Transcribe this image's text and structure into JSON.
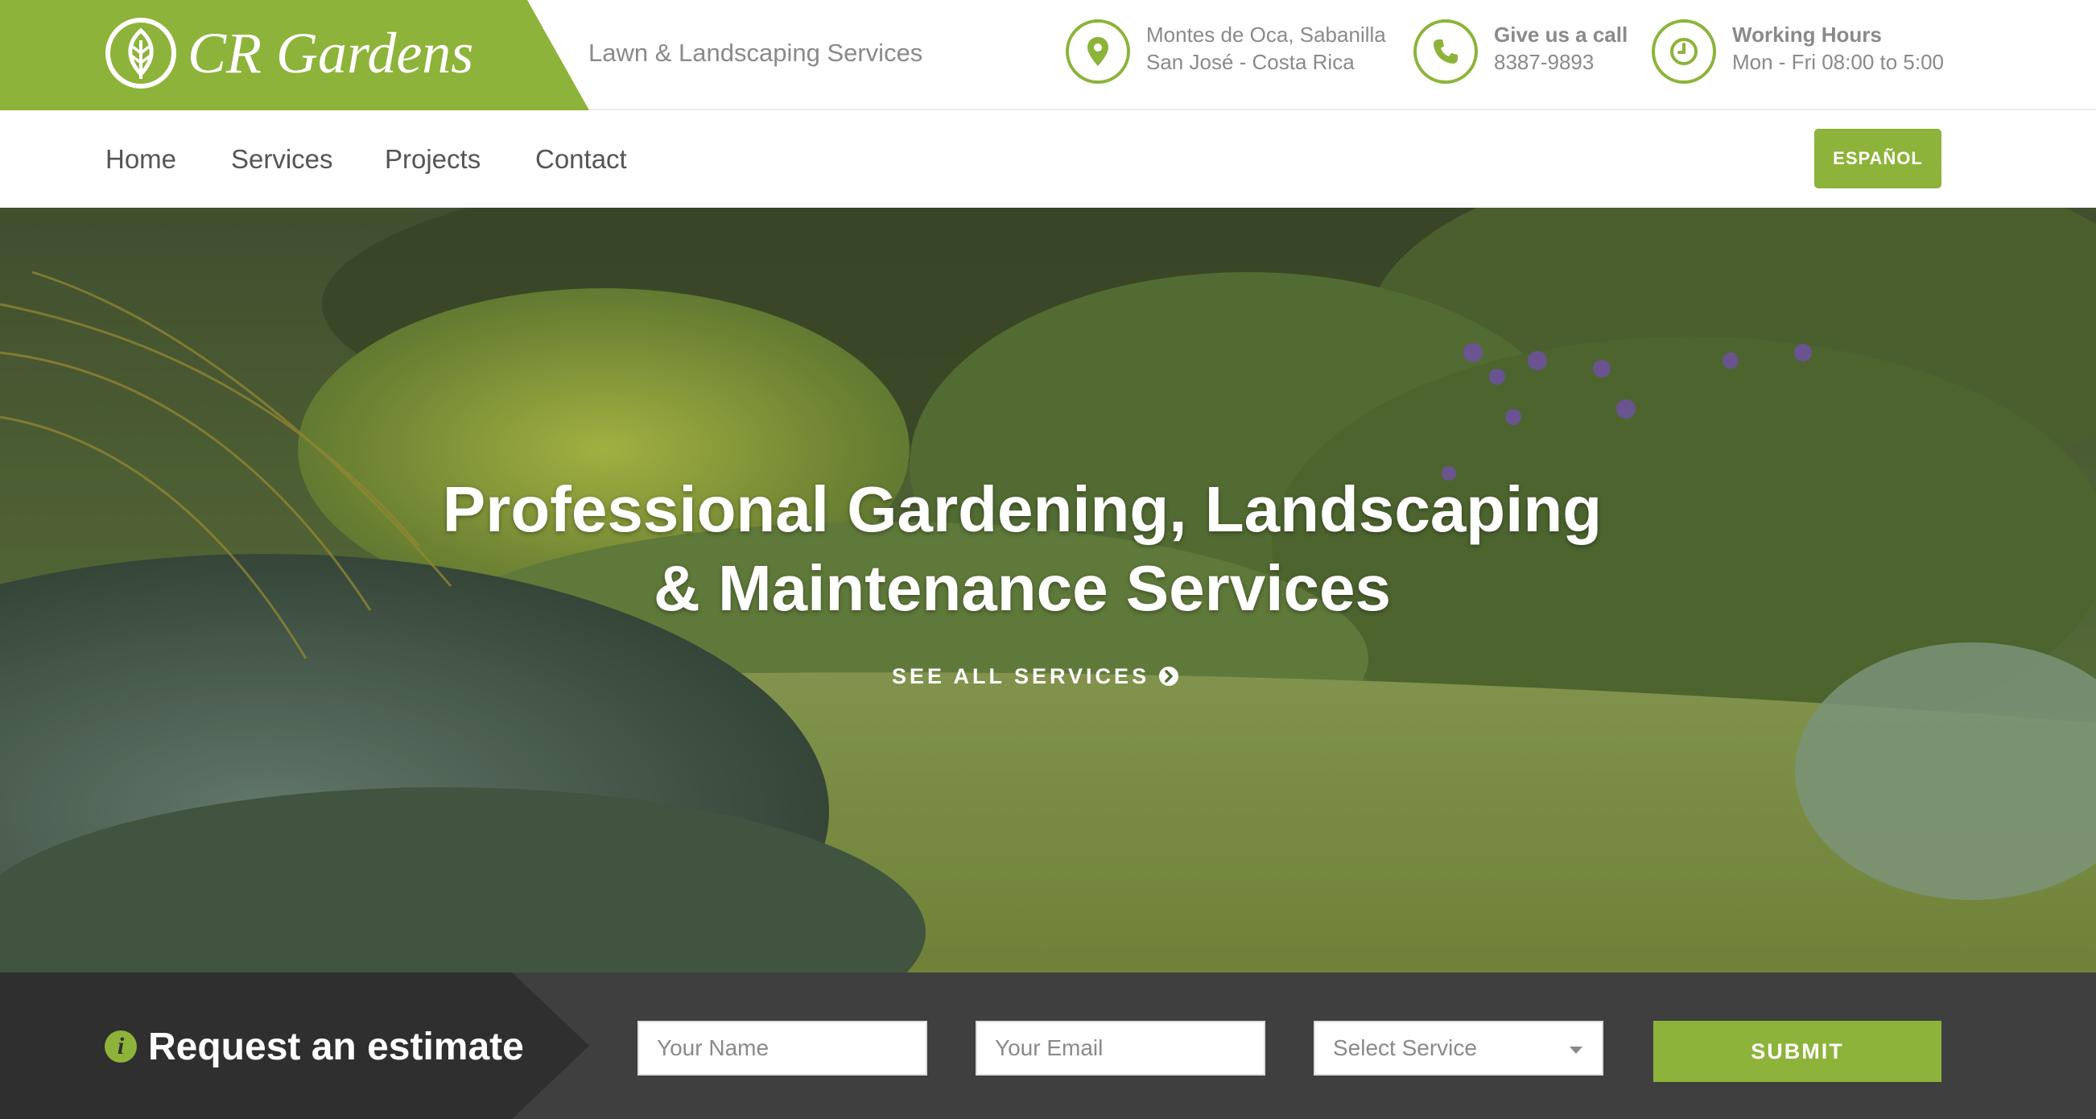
{
  "brand": {
    "name": "CR Gardens",
    "tagline": "Lawn & Landscaping Services",
    "logo_icon": "leaf-icon",
    "accent_color": "#8db33a"
  },
  "contact_info": {
    "location": {
      "icon": "map-pin-icon",
      "line1": "Montes de Oca, Sabanilla",
      "line2": "San José - Costa Rica"
    },
    "phone": {
      "icon": "phone-icon",
      "title": "Give us a call",
      "number": "8387-9893"
    },
    "hours": {
      "icon": "clock-icon",
      "title": "Working Hours",
      "schedule": "Mon - Fri 08:00 to 5:00"
    }
  },
  "nav": {
    "items": [
      "Home",
      "Services",
      "Projects",
      "Contact"
    ],
    "language_button": "ESPAÑOL"
  },
  "hero": {
    "title_line1": "Professional Gardening, Landscaping",
    "title_line2": "& Maintenance Services",
    "link_label": "SEE ALL SERVICES",
    "link_icon": "arrow-circle-right-icon"
  },
  "estimate": {
    "icon": "info-circle-icon",
    "title": "Request an estimate",
    "name_placeholder": "Your Name",
    "email_placeholder": "Your Email",
    "service_select": "Select Service",
    "submit_label": "SUBMIT",
    "bar_color": "#3f3f3f"
  }
}
